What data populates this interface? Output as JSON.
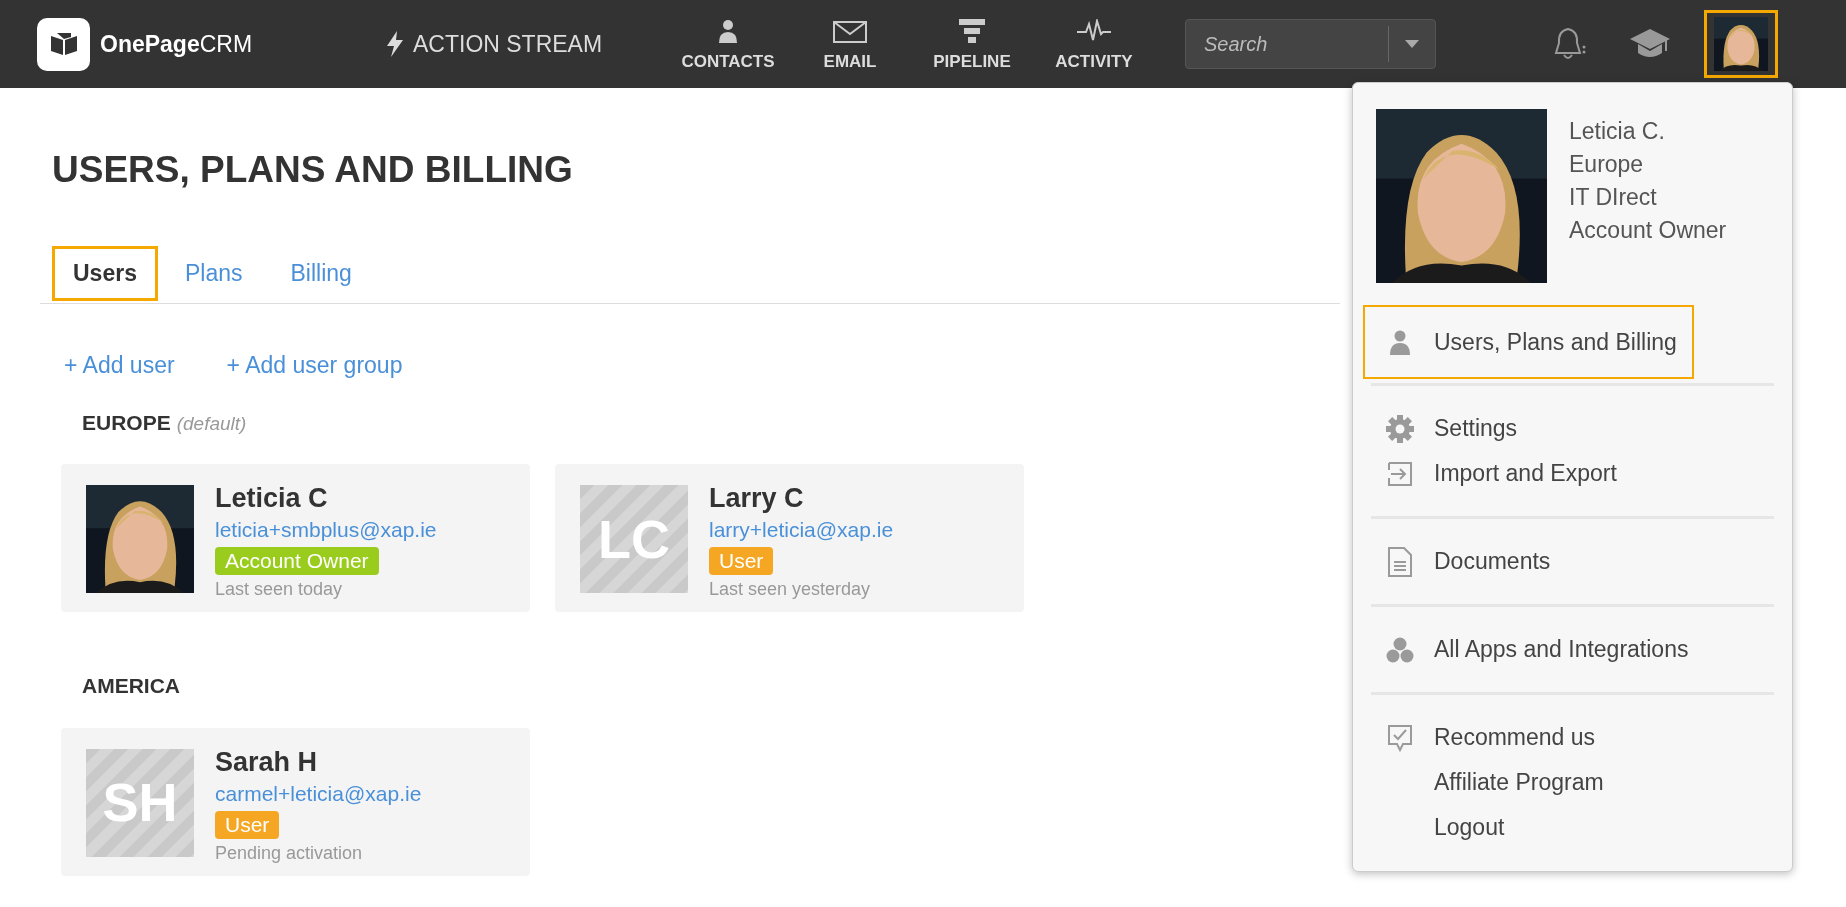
{
  "nav": {
    "logo": {
      "brand": "OnePage",
      "suffix": "CRM"
    },
    "action_stream": "ACTION STREAM",
    "items": [
      {
        "label": "CONTACTS",
        "kind": "person"
      },
      {
        "label": "EMAIL",
        "kind": "mail"
      },
      {
        "label": "PIPELINE",
        "kind": "funnel"
      },
      {
        "label": "ACTIVITY",
        "kind": "pulse"
      }
    ],
    "search": {
      "placeholder": "Search"
    },
    "avatar_highlighted": true
  },
  "page": {
    "title": "USERS, PLANS AND BILLING",
    "tabs": [
      {
        "label": "Users",
        "selected": true
      },
      {
        "label": "Plans",
        "selected": false
      },
      {
        "label": "Billing",
        "selected": false
      }
    ],
    "actions": [
      "+ Add user",
      "+ Add user group"
    ],
    "groups": [
      {
        "name": "EUROPE",
        "note": "(default)",
        "users": [
          {
            "name": "Leticia C",
            "email": "leticia+smbplus@xap.ie",
            "role": "Account Owner",
            "color": "#99cc1d",
            "status": "Last seen today"
          },
          {
            "name": "Larry C",
            "email": "larry+leticia@xap.ie",
            "role": "User",
            "color": "#f5a623",
            "status": "Last seen yesterday",
            "avatar": {
              "kind": "initials",
              "initials": "LC"
            }
          }
        ]
      },
      {
        "name": "AMERICA",
        "users": [
          {
            "name": "Sarah H",
            "email": "carmel+leticia@xap.ie",
            "role": "User",
            "color": "#f5a623",
            "status": "Pending activation",
            "avatar": {
              "kind": "initials",
              "initials": "SH"
            }
          }
        ]
      }
    ]
  },
  "profile_menu": {
    "details": [
      "Leticia C.",
      "Europe",
      "IT DIrect",
      "Account Owner"
    ],
    "groups": [
      {
        "items": [
          {
            "label": "Users, Plans and Billing",
            "kind": "person",
            "highlighted": true
          }
        ]
      },
      {
        "items": [
          {
            "label": "Settings",
            "kind": "gear",
            "highlighted": false
          },
          {
            "label": "Import and Export",
            "kind": "import",
            "highlighted": false
          }
        ]
      },
      {
        "items": [
          {
            "label": "Documents",
            "kind": "document",
            "highlighted": false
          }
        ]
      },
      {
        "items": [
          {
            "label": "All Apps and Integrations",
            "kind": "apps",
            "highlighted": false
          }
        ]
      },
      {
        "items": [
          {
            "label": "Recommend us",
            "kind": "recommend",
            "highlighted": false
          },
          {
            "label": "Affiliate Program",
            "kind": "plain",
            "highlighted": false
          },
          {
            "label": "Logout",
            "kind": "plain",
            "highlighted": false
          }
        ]
      }
    ]
  }
}
